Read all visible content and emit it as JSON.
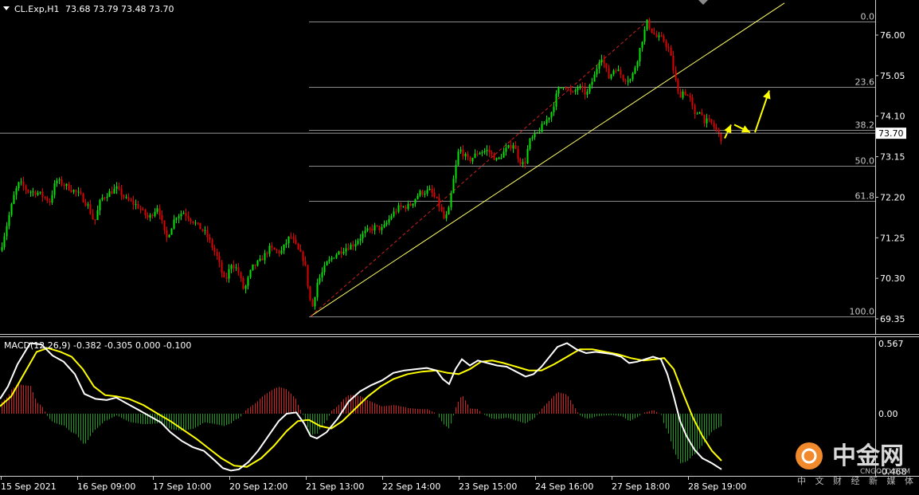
{
  "header": {
    "symbol": "CL.Exp,H1",
    "ohlc": "73.68 73.79 73.48 73.70"
  },
  "macd_header": "MACD(12,26,9) -0.382 -0.305 0.000 -0.100",
  "current_price": "73.70",
  "fib_labels": [
    "0.0",
    "23.6",
    "38.2",
    "50.0",
    "61.8",
    "100.0"
  ],
  "watermark": {
    "cn": "中金网",
    "sub": "中 文 财 经 新 媒 体",
    "url": "CNGOLD.COM"
  },
  "colors": {
    "bull": "#00e600",
    "bear": "#e00000",
    "trend": "#ffff66",
    "macd": "#ffffff",
    "signal": "#ffff00",
    "grid": "#8a8a8a",
    "arrow": "#ffff00"
  },
  "chart_data": [
    {
      "type": "candlestick",
      "title": "CL.Exp,H1",
      "ylim": [
        69.15,
        76.55
      ],
      "yticks": [
        "76.00",
        "75.05",
        "74.10",
        "73.15",
        "72.20",
        "71.25",
        "70.30",
        "69.35"
      ],
      "xticks": [
        "15 Sep 2021",
        "16 Sep 09:00",
        "17 Sep 10:00",
        "20 Sep 12:00",
        "21 Sep 13:00",
        "22 Sep 14:00",
        "23 Sep 15:00",
        "24 Sep 16:00",
        "27 Sep 18:00",
        "28 Sep 19:00"
      ],
      "close_path": [
        [
          0,
          70.95
        ],
        [
          6,
          71.4
        ],
        [
          18,
          72.3
        ],
        [
          24,
          72.55
        ],
        [
          34,
          72.35
        ],
        [
          48,
          72.3
        ],
        [
          62,
          72.1
        ],
        [
          70,
          72.6
        ],
        [
          84,
          72.45
        ],
        [
          100,
          72.25
        ],
        [
          110,
          72.0
        ],
        [
          118,
          71.6
        ],
        [
          126,
          72.15
        ],
        [
          136,
          72.3
        ],
        [
          146,
          72.4
        ],
        [
          158,
          72.15
        ],
        [
          172,
          72.0
        ],
        [
          186,
          71.7
        ],
        [
          198,
          72.0
        ],
        [
          208,
          71.2
        ],
        [
          220,
          71.75
        ],
        [
          230,
          71.85
        ],
        [
          244,
          71.6
        ],
        [
          258,
          71.35
        ],
        [
          272,
          70.8
        ],
        [
          282,
          70.2
        ],
        [
          290,
          70.65
        ],
        [
          298,
          70.5
        ],
        [
          306,
          70.0
        ],
        [
          316,
          70.55
        ],
        [
          326,
          70.7
        ],
        [
          338,
          71.0
        ],
        [
          352,
          70.9
        ],
        [
          364,
          71.3
        ],
        [
          374,
          70.95
        ],
        [
          382,
          70.7
        ],
        [
          386,
          70.15
        ],
        [
          391,
          69.55
        ],
        [
          398,
          70.2
        ],
        [
          410,
          70.65
        ],
        [
          420,
          70.85
        ],
        [
          432,
          71.0
        ],
        [
          444,
          71.1
        ],
        [
          456,
          71.35
        ],
        [
          470,
          71.5
        ],
        [
          480,
          71.45
        ],
        [
          492,
          71.8
        ],
        [
          500,
          71.95
        ],
        [
          514,
          72.0
        ],
        [
          526,
          72.3
        ],
        [
          540,
          72.35
        ],
        [
          550,
          72.05
        ],
        [
          558,
          71.65
        ],
        [
          563,
          71.9
        ],
        [
          568,
          72.5
        ],
        [
          576,
          73.35
        ],
        [
          588,
          73.05
        ],
        [
          600,
          73.25
        ],
        [
          612,
          73.3
        ],
        [
          624,
          73.05
        ],
        [
          634,
          73.3
        ],
        [
          644,
          73.45
        ],
        [
          652,
          73.05
        ],
        [
          658,
          72.95
        ],
        [
          664,
          73.5
        ],
        [
          674,
          73.7
        ],
        [
          684,
          73.95
        ],
        [
          692,
          74.2
        ],
        [
          700,
          74.7
        ],
        [
          708,
          74.85
        ],
        [
          718,
          74.6
        ],
        [
          726,
          74.8
        ],
        [
          736,
          74.6
        ],
        [
          746,
          75.05
        ],
        [
          754,
          75.55
        ],
        [
          764,
          75.0
        ],
        [
          772,
          75.25
        ],
        [
          782,
          75.0
        ],
        [
          792,
          74.95
        ],
        [
          800,
          75.45
        ],
        [
          806,
          75.9
        ],
        [
          812,
          76.3
        ],
        [
          818,
          76.1
        ],
        [
          824,
          75.95
        ],
        [
          832,
          75.9
        ],
        [
          840,
          75.65
        ],
        [
          846,
          75.1
        ],
        [
          852,
          74.55
        ],
        [
          858,
          74.7
        ],
        [
          866,
          74.5
        ],
        [
          872,
          74.1
        ],
        [
          878,
          74.25
        ],
        [
          884,
          74.0
        ],
        [
          892,
          73.95
        ],
        [
          900,
          73.75
        ],
        [
          906,
          73.55
        ]
      ],
      "fibonacci": [
        {
          "level": "0.0",
          "price": 76.32
        },
        {
          "level": "23.6",
          "price": 74.78
        },
        {
          "level": "38.2",
          "price": 73.77
        },
        {
          "level": "50.0",
          "price": 72.94
        },
        {
          "level": "61.8",
          "price": 72.11
        },
        {
          "level": "100.0",
          "price": 69.41
        }
      ],
      "trendlines": [
        {
          "style": "solid",
          "from": [
            390,
            69.41
          ],
          "to": [
            985,
            76.75
          ]
        },
        {
          "style": "dashed",
          "from": [
            390,
            69.41
          ],
          "to": [
            812,
            76.32
          ]
        }
      ],
      "arrows": [
        {
          "from": [
            910,
            73.58
          ],
          "to": [
            918,
            73.9
          ]
        },
        {
          "from": [
            922,
            73.9
          ],
          "to": [
            942,
            73.72
          ]
        },
        {
          "from": [
            948,
            73.72
          ],
          "to": [
            966,
            74.7
          ]
        }
      ],
      "current_price": 73.7
    },
    {
      "type": "macd",
      "title": "MACD(12,26,9) -0.382 -0.305 0.000 -0.100",
      "ylim": [
        -0.5,
        0.58
      ],
      "yticks": [
        "0.567",
        "0.00",
        "-0.468"
      ],
      "macd_line": [
        [
          0,
          0.12
        ],
        [
          10,
          0.22
        ],
        [
          22,
          0.4
        ],
        [
          38,
          0.57
        ],
        [
          52,
          0.56
        ],
        [
          66,
          0.47
        ],
        [
          80,
          0.42
        ],
        [
          94,
          0.32
        ],
        [
          106,
          0.16
        ],
        [
          120,
          0.12
        ],
        [
          134,
          0.11
        ],
        [
          146,
          0.13
        ],
        [
          160,
          0.08
        ],
        [
          174,
          0.03
        ],
        [
          188,
          -0.02
        ],
        [
          202,
          -0.07
        ],
        [
          214,
          -0.15
        ],
        [
          228,
          -0.22
        ],
        [
          242,
          -0.27
        ],
        [
          256,
          -0.3
        ],
        [
          270,
          -0.38
        ],
        [
          280,
          -0.44
        ],
        [
          290,
          -0.46
        ],
        [
          300,
          -0.45
        ],
        [
          312,
          -0.39
        ],
        [
          324,
          -0.3
        ],
        [
          338,
          -0.17
        ],
        [
          350,
          -0.06
        ],
        [
          360,
          0.0
        ],
        [
          372,
          0.01
        ],
        [
          382,
          -0.08
        ],
        [
          390,
          -0.18
        ],
        [
          398,
          -0.2
        ],
        [
          410,
          -0.15
        ],
        [
          424,
          -0.04
        ],
        [
          438,
          0.1
        ],
        [
          452,
          0.18
        ],
        [
          466,
          0.23
        ],
        [
          480,
          0.27
        ],
        [
          494,
          0.33
        ],
        [
          508,
          0.35
        ],
        [
          522,
          0.36
        ],
        [
          536,
          0.37
        ],
        [
          548,
          0.35
        ],
        [
          556,
          0.28
        ],
        [
          564,
          0.24
        ],
        [
          572,
          0.36
        ],
        [
          580,
          0.44
        ],
        [
          590,
          0.39
        ],
        [
          600,
          0.43
        ],
        [
          612,
          0.41
        ],
        [
          624,
          0.39
        ],
        [
          636,
          0.38
        ],
        [
          648,
          0.34
        ],
        [
          660,
          0.3
        ],
        [
          670,
          0.32
        ],
        [
          680,
          0.38
        ],
        [
          690,
          0.46
        ],
        [
          700,
          0.54
        ],
        [
          712,
          0.57
        ],
        [
          724,
          0.52
        ],
        [
          736,
          0.49
        ],
        [
          748,
          0.5
        ],
        [
          760,
          0.49
        ],
        [
          770,
          0.48
        ],
        [
          780,
          0.46
        ],
        [
          790,
          0.41
        ],
        [
          800,
          0.42
        ],
        [
          810,
          0.44
        ],
        [
          820,
          0.46
        ],
        [
          830,
          0.44
        ],
        [
          838,
          0.32
        ],
        [
          846,
          0.14
        ],
        [
          854,
          -0.06
        ],
        [
          862,
          -0.18
        ],
        [
          872,
          -0.29
        ],
        [
          882,
          -0.36
        ],
        [
          894,
          -0.4
        ],
        [
          906,
          -0.45
        ]
      ],
      "signal_line": [
        [
          0,
          0.06
        ],
        [
          14,
          0.14
        ],
        [
          30,
          0.32
        ],
        [
          46,
          0.5
        ],
        [
          60,
          0.53
        ],
        [
          76,
          0.5
        ],
        [
          90,
          0.46
        ],
        [
          104,
          0.36
        ],
        [
          118,
          0.22
        ],
        [
          132,
          0.15
        ],
        [
          146,
          0.14
        ],
        [
          162,
          0.12
        ],
        [
          180,
          0.07
        ],
        [
          198,
          0.0
        ],
        [
          214,
          -0.06
        ],
        [
          230,
          -0.13
        ],
        [
          246,
          -0.2
        ],
        [
          262,
          -0.28
        ],
        [
          278,
          -0.36
        ],
        [
          294,
          -0.42
        ],
        [
          310,
          -0.43
        ],
        [
          328,
          -0.36
        ],
        [
          344,
          -0.26
        ],
        [
          360,
          -0.14
        ],
        [
          374,
          -0.06
        ],
        [
          388,
          -0.05
        ],
        [
          402,
          -0.1
        ],
        [
          416,
          -0.12
        ],
        [
          430,
          -0.06
        ],
        [
          446,
          0.04
        ],
        [
          462,
          0.14
        ],
        [
          478,
          0.22
        ],
        [
          494,
          0.28
        ],
        [
          512,
          0.32
        ],
        [
          530,
          0.34
        ],
        [
          548,
          0.35
        ],
        [
          562,
          0.33
        ],
        [
          576,
          0.32
        ],
        [
          590,
          0.36
        ],
        [
          604,
          0.42
        ],
        [
          618,
          0.43
        ],
        [
          632,
          0.41
        ],
        [
          648,
          0.38
        ],
        [
          664,
          0.35
        ],
        [
          680,
          0.35
        ],
        [
          696,
          0.4
        ],
        [
          712,
          0.46
        ],
        [
          728,
          0.52
        ],
        [
          744,
          0.52
        ],
        [
          760,
          0.5
        ],
        [
          776,
          0.48
        ],
        [
          792,
          0.45
        ],
        [
          808,
          0.43
        ],
        [
          822,
          0.44
        ],
        [
          834,
          0.45
        ],
        [
          846,
          0.36
        ],
        [
          858,
          0.16
        ],
        [
          870,
          -0.03
        ],
        [
          882,
          -0.18
        ],
        [
          894,
          -0.3
        ],
        [
          906,
          -0.38
        ]
      ]
    }
  ]
}
